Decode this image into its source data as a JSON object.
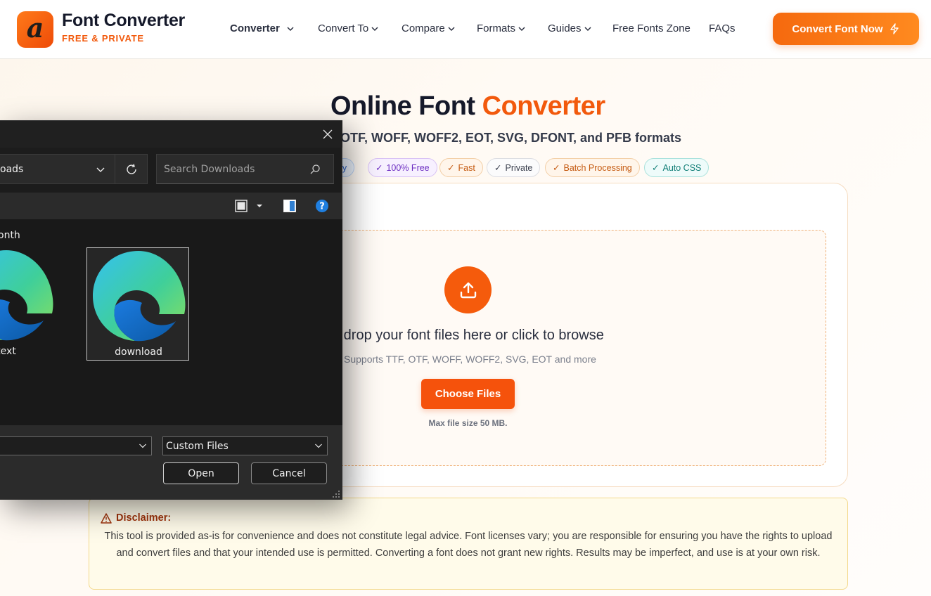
{
  "brand": {
    "logo_glyph": "a",
    "title": "Font Converter",
    "subtitle": "FREE & PRIVATE"
  },
  "nav": {
    "items": [
      {
        "label": "Converter",
        "has_dropdown": true,
        "active": true
      },
      {
        "label": "Convert To",
        "has_dropdown": true
      },
      {
        "label": "Compare",
        "has_dropdown": true
      },
      {
        "label": "Formats",
        "has_dropdown": true
      },
      {
        "label": "Guides",
        "has_dropdown": true
      },
      {
        "label": "Free Fonts Zone",
        "has_dropdown": false
      },
      {
        "label": "FAQs",
        "has_dropdown": false
      }
    ],
    "cta_label": "Convert Font Now",
    "cta_icon": "lightning-icon"
  },
  "hero": {
    "title_main": "Online Font ",
    "title_accent": "Converter",
    "subtitle": "OTF, WOFF, WOFF2, EOT, SVG, DFONT, and PFB formats",
    "badges": [
      {
        "label": "rely",
        "style": "blue"
      },
      {
        "label": "100% Free",
        "style": "purple"
      },
      {
        "label": "Fast",
        "style": "orange"
      },
      {
        "label": "Private",
        "style": "gray"
      },
      {
        "label": "Batch Processing",
        "style": "orange"
      },
      {
        "label": "Auto CSS",
        "style": "teal"
      }
    ]
  },
  "upload": {
    "icon": "upload-icon",
    "title": "d drop your font files here or click to browse",
    "supports": "Supports TTF, OTF, WOFF, WOFF2, SVG, EOT and more",
    "button_label": "Choose Files",
    "max_size": "Max file size 50 MB."
  },
  "disclaimer": {
    "title": "Disclaimer:",
    "text": "This tool is provided as-is for convenience and does not constitute legal advice. Font licenses vary; you are responsible for ensuring you have the rights to upload and convert files and that your intended use is permitted. Converting a font does not grant new rights. Results may be imperfect, and use is at your own risk."
  },
  "dialog": {
    "address": "oads",
    "search_placeholder": "Search Downloads",
    "group_label": "onth",
    "files": [
      {
        "name": "text",
        "icon": "edge-browser-icon",
        "selected": false
      },
      {
        "name": "download",
        "icon": "edge-browser-icon",
        "selected": true
      }
    ],
    "filename_value": "",
    "filetype_value": "Custom Files",
    "open_label": "Open",
    "cancel_label": "Cancel"
  },
  "colors": {
    "accent": "#f2590c",
    "cta_start": "#f5690e",
    "cta_end": "#ff8a1f",
    "dialog_bg": "#1c1c1c"
  }
}
